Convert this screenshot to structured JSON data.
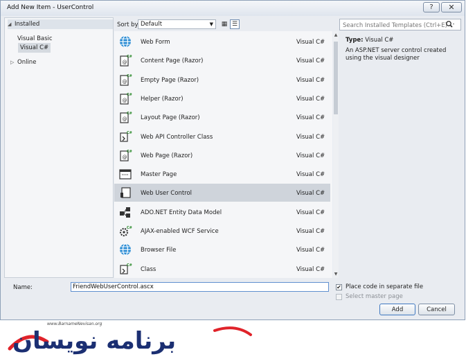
{
  "window": {
    "title": "Add New Item - UserControl",
    "help": "?",
    "close": "✕"
  },
  "tree": {
    "installed": "Installed",
    "items": [
      "Visual Basic",
      "Visual C#"
    ],
    "online": "Online"
  },
  "toolbar": {
    "sort_label": "Sort by:",
    "sort_value": "Default"
  },
  "templates": [
    {
      "name": "Web Form",
      "lang": "Visual C#",
      "icon": "globe-icon"
    },
    {
      "name": "Content Page (Razor)",
      "lang": "Visual C#",
      "icon": "razor-page-icon"
    },
    {
      "name": "Empty Page (Razor)",
      "lang": "Visual C#",
      "icon": "razor-page-icon"
    },
    {
      "name": "Helper (Razor)",
      "lang": "Visual C#",
      "icon": "razor-page-icon"
    },
    {
      "name": "Layout Page (Razor)",
      "lang": "Visual C#",
      "icon": "razor-page-icon"
    },
    {
      "name": "Web API Controller Class",
      "lang": "Visual C#",
      "icon": "csharp-class-icon"
    },
    {
      "name": "Web Page (Razor)",
      "lang": "Visual C#",
      "icon": "razor-page-icon"
    },
    {
      "name": "Master Page",
      "lang": "Visual C#",
      "icon": "master-page-icon"
    },
    {
      "name": "Web User Control",
      "lang": "Visual C#",
      "icon": "user-control-icon",
      "selected": true
    },
    {
      "name": "ADO.NET Entity Data Model",
      "lang": "Visual C#",
      "icon": "entity-model-icon"
    },
    {
      "name": "AJAX-enabled WCF Service",
      "lang": "Visual C#",
      "icon": "wcf-service-icon"
    },
    {
      "name": "Browser File",
      "lang": "Visual C#",
      "icon": "globe-icon"
    },
    {
      "name": "Class",
      "lang": "Visual C#",
      "icon": "csharp-class-icon"
    }
  ],
  "search": {
    "placeholder": "Search Installed Templates (Ctrl+E)"
  },
  "details": {
    "type_label": "Type:",
    "type_value": "Visual C#",
    "description": "An ASP.NET server control created using the visual designer"
  },
  "form": {
    "name_label": "Name:",
    "name_value": "FriendWebUserControl.ascx",
    "place_code_label": "Place code in separate file",
    "place_code_checked": true,
    "master_label": "Select master page",
    "master_checked": false
  },
  "buttons": {
    "add": "Add",
    "cancel": "Cancel"
  },
  "logo": {
    "url": "www.BarnameNevisan.org",
    "text": "برنامه نویسان"
  },
  "colors": {
    "selection": "#cfd4db",
    "accent": "#1b2f72",
    "logo_red": "#e0232a"
  }
}
